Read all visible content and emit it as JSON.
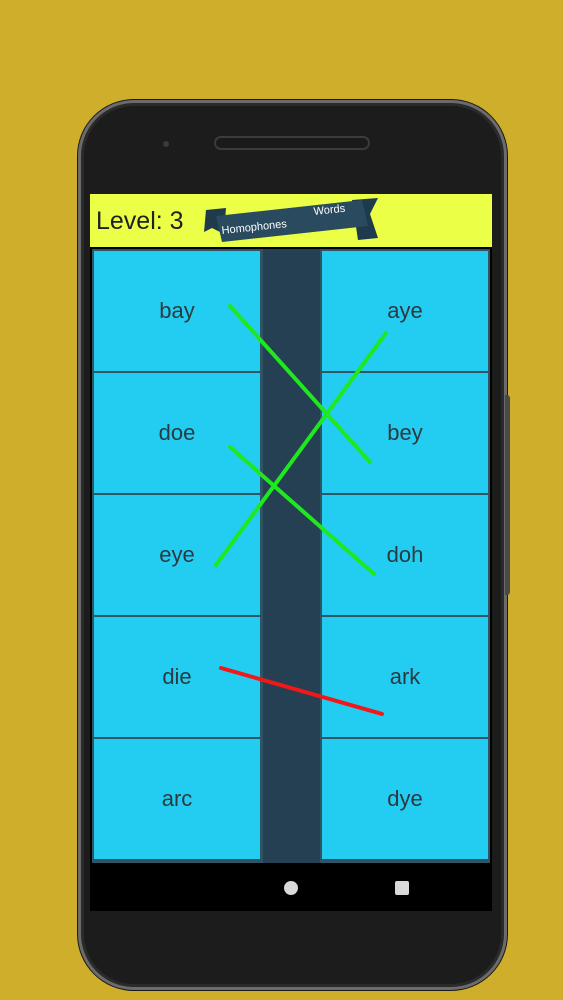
{
  "header": {
    "level_text": "Level: 3",
    "banner_left": "Homophones",
    "banner_right": "Words"
  },
  "left_words": [
    "bay",
    "doe",
    "eye",
    "die",
    "arc"
  ],
  "right_words": [
    "aye",
    "bey",
    "doh",
    "ark",
    "dye"
  ],
  "connections": [
    {
      "from": "bay",
      "to": "bey",
      "status": "correct",
      "color": "#1fe81f"
    },
    {
      "from": "eye",
      "to": "aye",
      "status": "correct",
      "color": "#1fe81f"
    },
    {
      "from": "doe",
      "to": "doh",
      "status": "correct",
      "color": "#1fe81f"
    },
    {
      "from": "die",
      "to": "ark",
      "status": "wrong",
      "color": "#f21818"
    }
  ],
  "colors": {
    "background": "#cfae2b",
    "header": "#eaff45",
    "cell": "#23cdf2",
    "divider": "#244052",
    "correct": "#1fe81f",
    "wrong": "#f21818"
  },
  "nav": {
    "home_icon": "circle-home-icon",
    "recent_icon": "square-recents-icon"
  }
}
